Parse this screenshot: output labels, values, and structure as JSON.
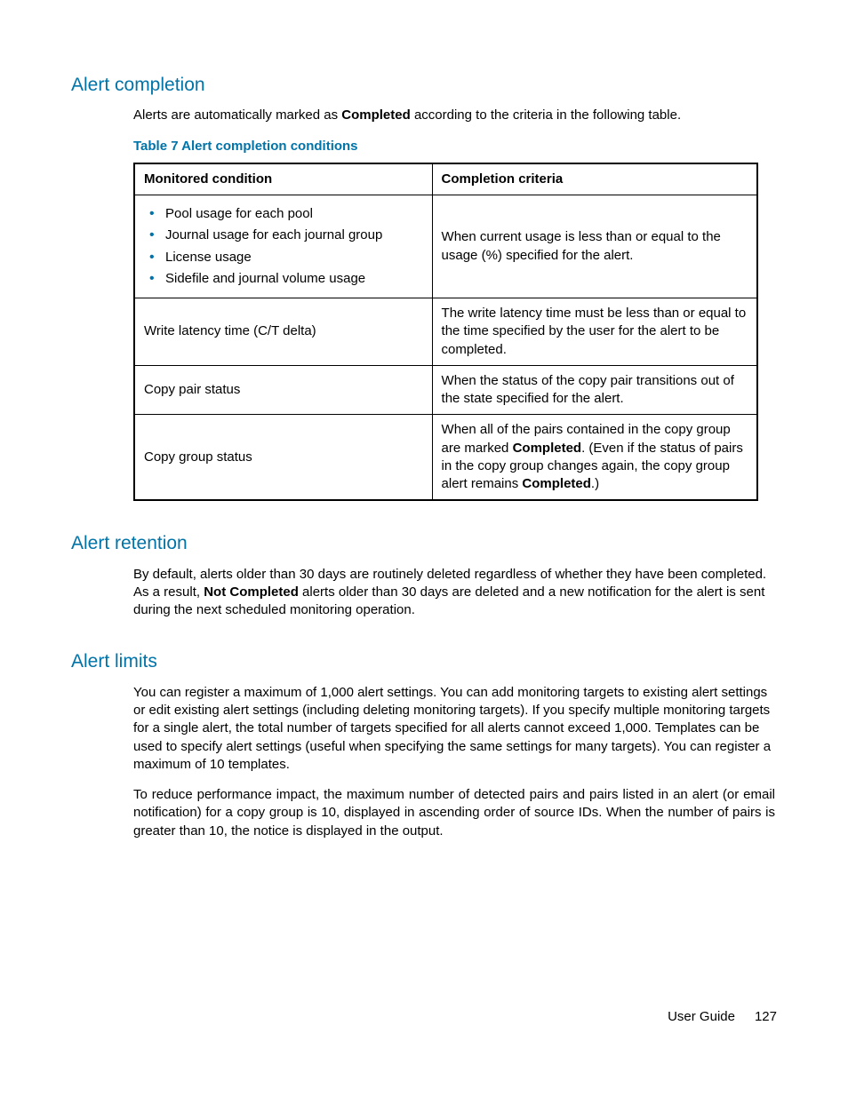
{
  "sections": {
    "completion": {
      "heading": "Alert completion",
      "intro_parts": [
        "Alerts are automatically marked as ",
        "Completed",
        " according to the criteria in the following table."
      ],
      "table_caption": "Table 7 Alert completion conditions",
      "table": {
        "headers": [
          "Monitored condition",
          "Completion criteria"
        ],
        "rows": [
          {
            "condition_bullets": [
              "Pool usage for each pool",
              "Journal usage for each journal group",
              "License usage",
              "Sidefile and journal volume usage"
            ],
            "criteria": "When current usage is less than or equal to the usage (%) specified for the alert."
          },
          {
            "condition": "Write latency time (C/T delta)",
            "criteria": "The write latency time must be less than or equal to the time specified by the user for the alert to be completed."
          },
          {
            "condition": "Copy pair status",
            "criteria": "When the status of the copy pair transitions out of the state specified for the alert."
          },
          {
            "condition": "Copy group status",
            "criteria_parts": [
              "When all of the pairs contained in the copy group are marked ",
              "Completed",
              ". (Even if the status of pairs in the copy group changes again, the copy group alert remains ",
              "Completed",
              ".)"
            ]
          }
        ]
      }
    },
    "retention": {
      "heading": "Alert retention",
      "body_parts": [
        "By default, alerts older than 30 days are routinely deleted regardless of whether they have been completed. As a result, ",
        "Not Completed",
        " alerts older than 30 days are deleted and a new notification for the alert is sent during the next scheduled monitoring operation."
      ]
    },
    "limits": {
      "heading": "Alert limits",
      "para1": "You can register a maximum of 1,000 alert settings. You can add monitoring targets to existing alert settings or edit existing alert settings (including deleting monitoring targets). If you specify multiple monitoring targets for a single alert, the total number of targets specified for all alerts cannot exceed 1,000. Templates can be used to specify alert settings (useful when specifying the same settings for many targets). You can register a maximum of 10 templates.",
      "para2_lead": "To reduce performance impact, the maximum number of detected pairs and pairs listed in an alert (or email notification) for a copy group is 10, displayed in ascending order of source IDs. When the number of pairs is greater than 10, the notice ",
      "para2_tail": " is displayed in the output."
    }
  },
  "footer": {
    "label": "User Guide",
    "page": "127"
  }
}
